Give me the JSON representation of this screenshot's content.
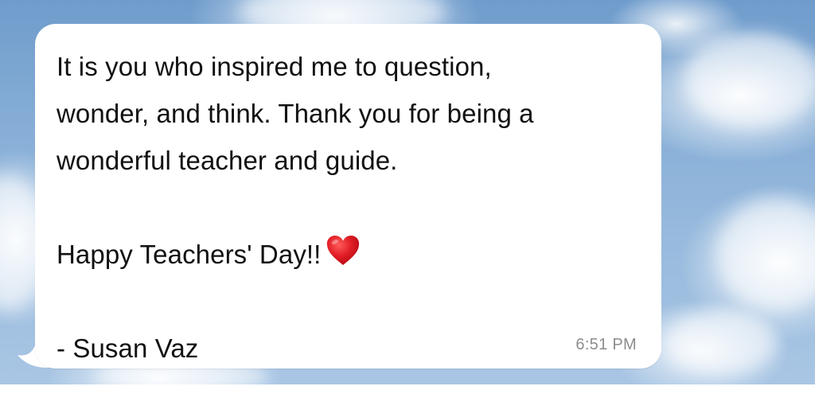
{
  "background": {
    "sky_color": "#7fa9d6",
    "cloud_color": "#ffffff"
  },
  "message": {
    "line_1": "It is you who inspired me to question,",
    "line_2": "wonder, and think. Thank you for being a",
    "line_3": "wonderful teacher and guide.",
    "line_4": "Happy Teachers' Day!!",
    "signature": "- Susan Vaz",
    "emoji_icon": "red-heart-icon",
    "time": "6:51 PM"
  }
}
